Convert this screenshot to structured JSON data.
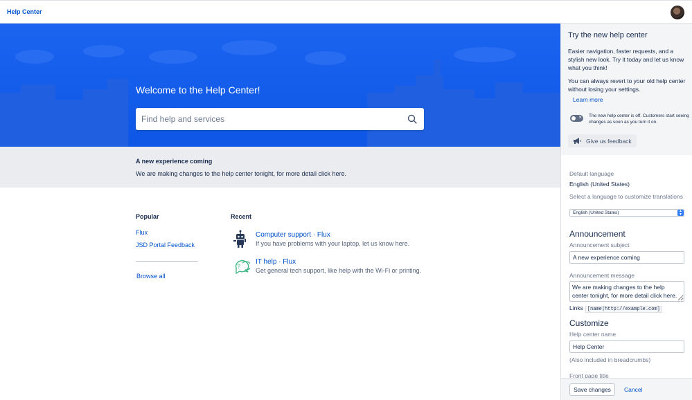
{
  "topnav": {
    "brand": "Help Center"
  },
  "hero": {
    "welcome": "Welcome to the Help Center!",
    "search_placeholder": "Find help and services"
  },
  "announcement": {
    "title": "A new experience coming",
    "message": "We are making changes to the help center tonight, for more detail click here."
  },
  "popular": {
    "heading": "Popular",
    "links": [
      "Flux",
      "JSD Portal Feedback"
    ],
    "browse_all": "Browse all"
  },
  "recent": {
    "heading": "Recent",
    "items": [
      {
        "title": "Computer support · Flux",
        "description": "If you have problems with your laptop, let us know here.",
        "icon": "robot-icon"
      },
      {
        "title": "IT help · Flux",
        "description": "Get general tech support, like help with the Wi-Fi or printing.",
        "icon": "chat-question-icon"
      }
    ]
  },
  "panel": {
    "try": {
      "title": "Try the new help center",
      "p1": "Easier navigation, faster requests, and a stylish new look. Try it today and let us know what you think!",
      "p2": "You can always revert to your old help center without losing your settings.",
      "learn_more": "Learn more",
      "toggle_text": "The new help center is off. Customers start seeing changes as soon as you turn it on.",
      "toggle_state": "off",
      "feedback": "Give us feedback"
    },
    "language": {
      "default_label": "Default language",
      "default_value": "English (United States)",
      "select_label": "Select a language to customize translations",
      "select_value": "English (United States)"
    },
    "announcement": {
      "heading": "Announcement",
      "subject_label": "Announcement subject",
      "subject_value": "A new experience coming",
      "message_label": "Announcement message",
      "message_value": "We are making changes to the help center tonight, for more detail click here.",
      "links_label": "Links",
      "links_code": "[name|http://example.com]"
    },
    "customize": {
      "heading": "Customize",
      "name_label": "Help center name",
      "name_value": "Help Center",
      "name_note": "(Also included in breadcrumbs)",
      "front_title_label": "Front page title"
    },
    "footer": {
      "save": "Save changes",
      "cancel": "Cancel"
    }
  },
  "colors": {
    "hero_blue": "#0E57E6",
    "link_blue": "#0052CC",
    "text": "#172B4D",
    "announce_bg": "#EBECF0"
  }
}
